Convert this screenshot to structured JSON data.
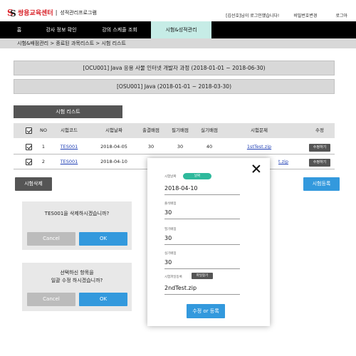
{
  "header": {
    "brand": "쌍용교육센터",
    "program": "성적관리프로그램",
    "welcome": "[김선호]님이 로그인했습니다!",
    "change_password": "비밀번호변경",
    "logout": "로그아"
  },
  "nav": {
    "items": [
      {
        "label": "홈"
      },
      {
        "label": "강사 정보 확인"
      },
      {
        "label": "강의 스케줄 조회"
      },
      {
        "label": "시험&성적관리"
      }
    ],
    "active_index": 3,
    "active_color": "#c6ece6"
  },
  "breadcrumb": "시험&배점관리 > 종료된 과목리스트 > 시험 리스트",
  "course": {
    "title": "[OCU001] Java 응용 사물 인터넷 개발자 과정 (2018-01-01 ~ 2018-06-30)",
    "subject": "[OSU001] Java  (2018-01-01 ~ 2018-03-30)"
  },
  "exam_list_button": "시험 리스트",
  "table": {
    "headers": [
      "NO",
      "시험코드",
      "시험날짜",
      "출결배점",
      "필기배점",
      "실기배점",
      "시험문제",
      "수정"
    ],
    "rows": [
      {
        "no": "1",
        "code": "TES001",
        "date": "2018-04-05",
        "attendance": "30",
        "written": "30",
        "practical": "40",
        "file": "1stTest.zip",
        "edit": "수정하기"
      },
      {
        "no": "2",
        "code": "TES001",
        "date": "2018-04-10",
        "file_partial": "t.zip",
        "edit": "수정하기"
      }
    ]
  },
  "actions": {
    "delete": "시험삭제",
    "register": "시험등록"
  },
  "delete_dialog": {
    "message": "TES001을 삭제하시겠습니까?",
    "cancel": "Cancel",
    "ok": "OK"
  },
  "edit_confirm_dialog": {
    "line1": "선택하신 항목을",
    "line2": "일괄 수정 하시겠습니까?",
    "cancel": "Cancel",
    "ok": "OK"
  },
  "edit_modal": {
    "date_label": "시험날짜",
    "date_badge": "날짜",
    "date_value": "2018-04-10",
    "attendance_label": "출석배점",
    "attendance_value": "30",
    "written_label": "필기배점",
    "written_value": "30",
    "practical_label": "실기배점",
    "practical_value": "30",
    "file_label": "시험파일등록",
    "file_button": "파일찾기",
    "file_value": "2ndTest.zip",
    "submit": "수정 or 등록"
  },
  "colors": {
    "primary_blue": "#3399dd",
    "dark_button": "#555555",
    "date_badge": "#2fb99c",
    "brand_red": "#d81f26"
  }
}
